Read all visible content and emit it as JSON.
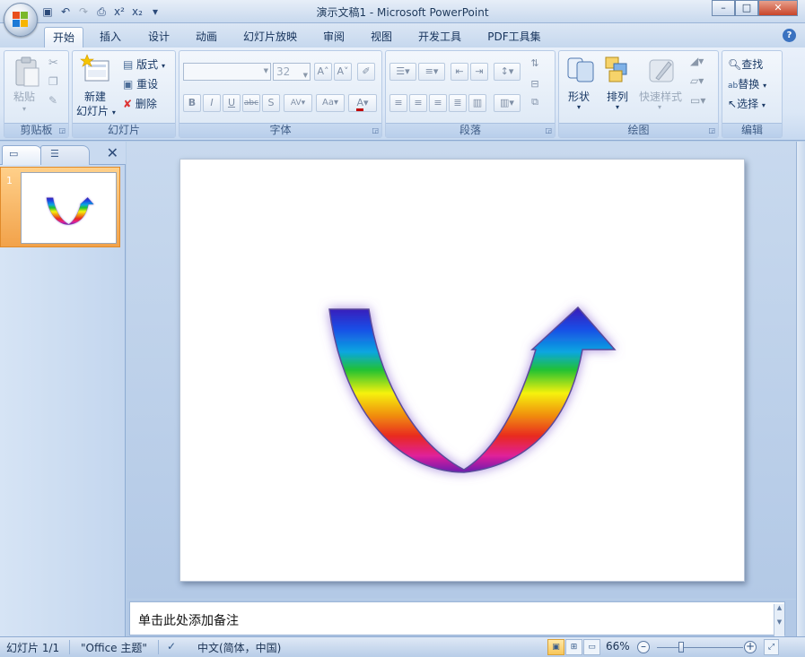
{
  "window": {
    "title": "演示文稿1 - Microsoft PowerPoint"
  },
  "tabs": [
    "开始",
    "插入",
    "设计",
    "动画",
    "幻灯片放映",
    "审阅",
    "视图",
    "开发工具",
    "PDF工具集"
  ],
  "ribbon": {
    "clipboard": {
      "label": "剪贴板",
      "paste": "粘贴"
    },
    "slides": {
      "label": "幻灯片",
      "new_slide_line1": "新建",
      "new_slide_line2": "幻灯片",
      "layout": "版式",
      "reset": "重设",
      "delete": "删除"
    },
    "font": {
      "label": "字体",
      "font_name": "",
      "font_size": "32"
    },
    "paragraph": {
      "label": "段落"
    },
    "drawing": {
      "label": "绘图",
      "shapes": "形状",
      "arrange": "排列",
      "quick_styles": "快速样式"
    },
    "editing": {
      "label": "编辑",
      "find": "查找",
      "replace": "替换",
      "select": "选择"
    }
  },
  "slides_panel": {
    "slide_number": "1"
  },
  "notes": {
    "placeholder": "单击此处添加备注"
  },
  "status": {
    "slide_indicator": "幻灯片 1/1",
    "theme": "\"Office 主题\"",
    "language": "中文(简体，中国)",
    "zoom": "66%"
  },
  "colors": {
    "arrow_gradient": [
      "#3a1ab8",
      "#1a4de6",
      "#0aa6e0",
      "#22c232",
      "#f6f20c",
      "#f08a10",
      "#e82a20",
      "#e0209a",
      "#6a1ab0"
    ],
    "glow": "#9a7ad8",
    "arrowhead": "#2a3ae8"
  }
}
